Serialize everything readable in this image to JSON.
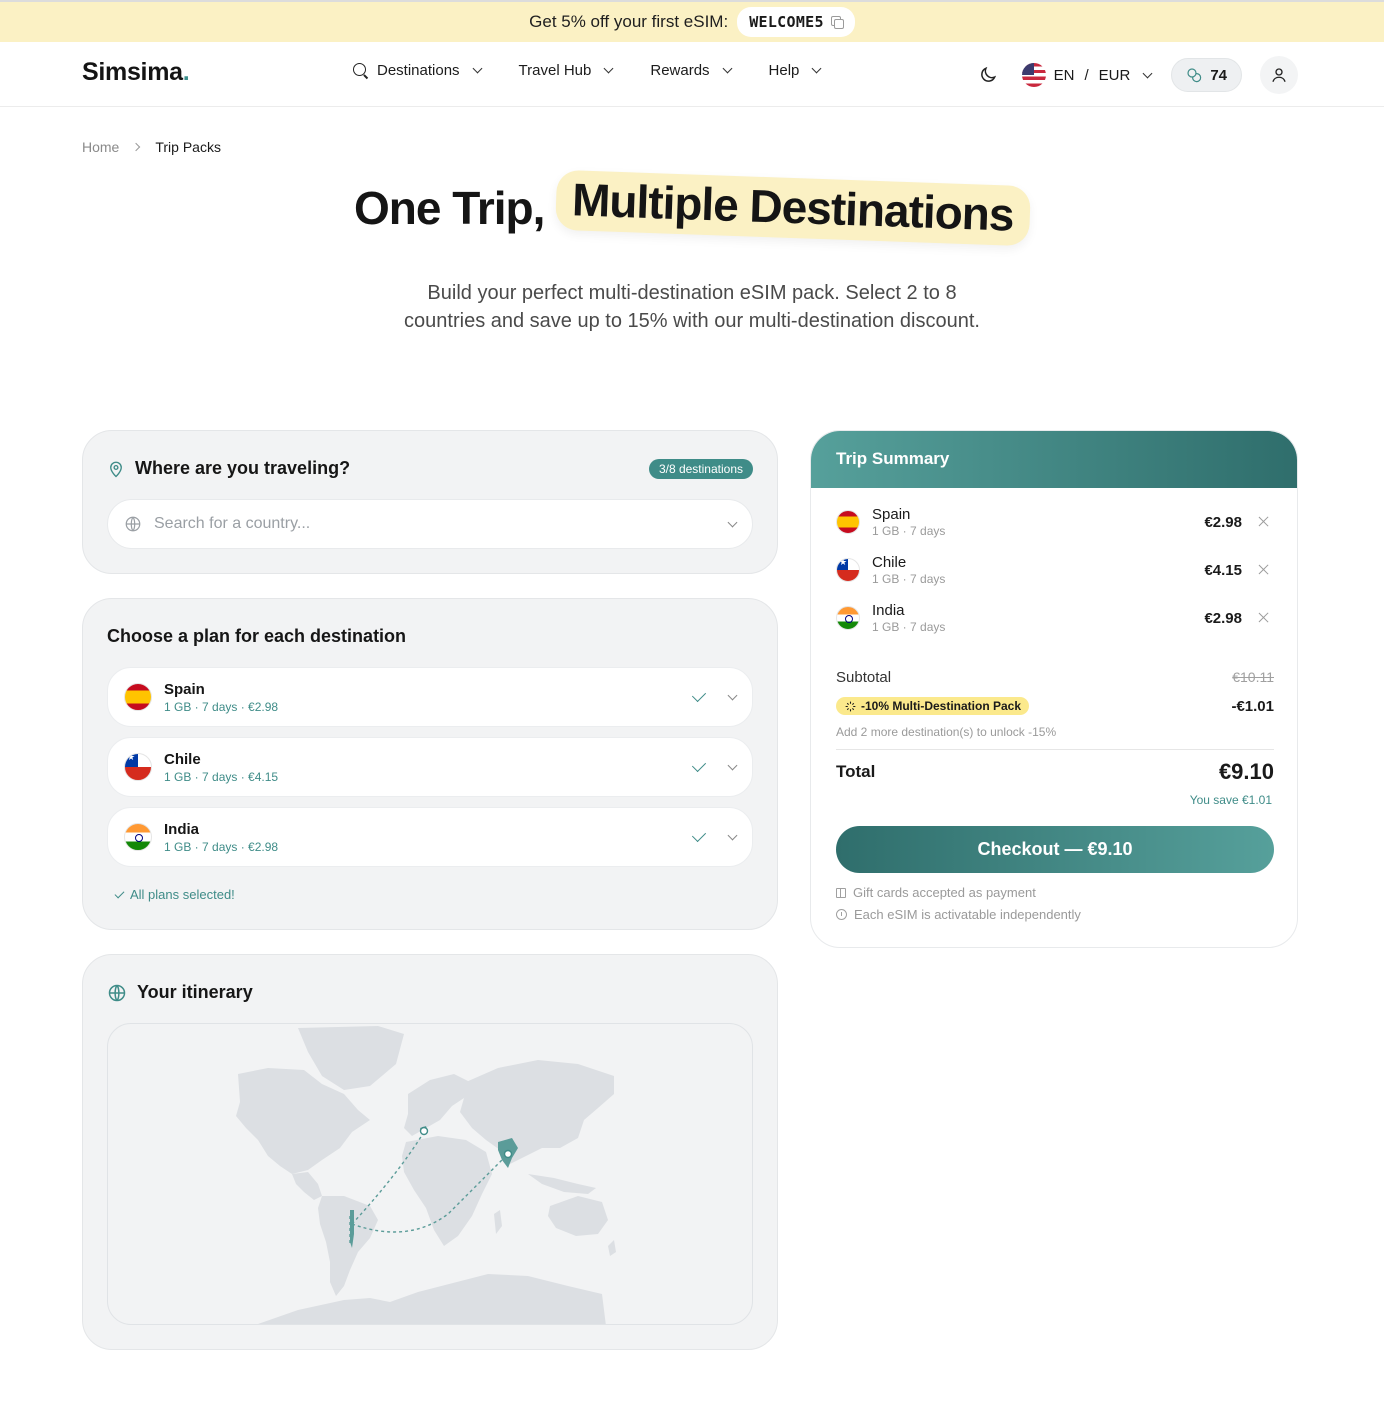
{
  "promo": {
    "text": "Get 5% off your first eSIM:",
    "code": "WELCOME5"
  },
  "header": {
    "logo": "Simsima",
    "logo_dot": ".",
    "nav": [
      {
        "label": "Destinations",
        "icon": "search-icon"
      },
      {
        "label": "Travel Hub"
      },
      {
        "label": "Rewards"
      },
      {
        "label": "Help"
      }
    ],
    "language": "EN",
    "separator": "/",
    "currency": "EUR",
    "points": "74"
  },
  "breadcrumb": {
    "home": "Home",
    "current": "Trip Packs"
  },
  "hero": {
    "title_plain": "One Trip,",
    "title_highlight": "Multiple Destinations",
    "subtitle_line1": "Build your perfect multi-destination eSIM pack. Select 2 to 8",
    "subtitle_line2": "countries and save up to 15% with our multi-destination discount."
  },
  "where": {
    "title": "Where are you traveling?",
    "badge": "3/8 destinations",
    "search_placeholder": "Search for a country..."
  },
  "plans": {
    "title": "Choose a plan for each destination",
    "items": [
      {
        "name": "Spain",
        "detail": "1 GB · 7 days · €2.98"
      },
      {
        "name": "Chile",
        "detail": "1 GB · 7 days · €4.15"
      },
      {
        "name": "India",
        "detail": "1 GB · 7 days · €2.98"
      }
    ],
    "status": "All plans selected!"
  },
  "itinerary": {
    "title": "Your itinerary"
  },
  "summary": {
    "title": "Trip Summary",
    "items": [
      {
        "name": "Spain",
        "detail": "1 GB · 7 days",
        "price": "€2.98"
      },
      {
        "name": "Chile",
        "detail": "1 GB · 7 days",
        "price": "€4.15"
      },
      {
        "name": "India",
        "detail": "1 GB · 7 days",
        "price": "€2.98"
      }
    ],
    "subtotal_label": "Subtotal",
    "subtotal_value": "€10.11",
    "discount_label": "-10% Multi-Destination Pack",
    "discount_value": "-€1.01",
    "unlock_text": "Add 2 more destination(s) to unlock -15%",
    "total_label": "Total",
    "total_value": "€9.10",
    "you_save": "You save €1.01",
    "checkout_label": "Checkout — €9.10",
    "note_gift": "Gift cards accepted as payment",
    "note_activate": "Each eSIM is activatable independently"
  },
  "colors": {
    "accent": "#3f8c88",
    "promo_bg": "#fbf1c4",
    "discount_bg": "#fbe98c"
  }
}
